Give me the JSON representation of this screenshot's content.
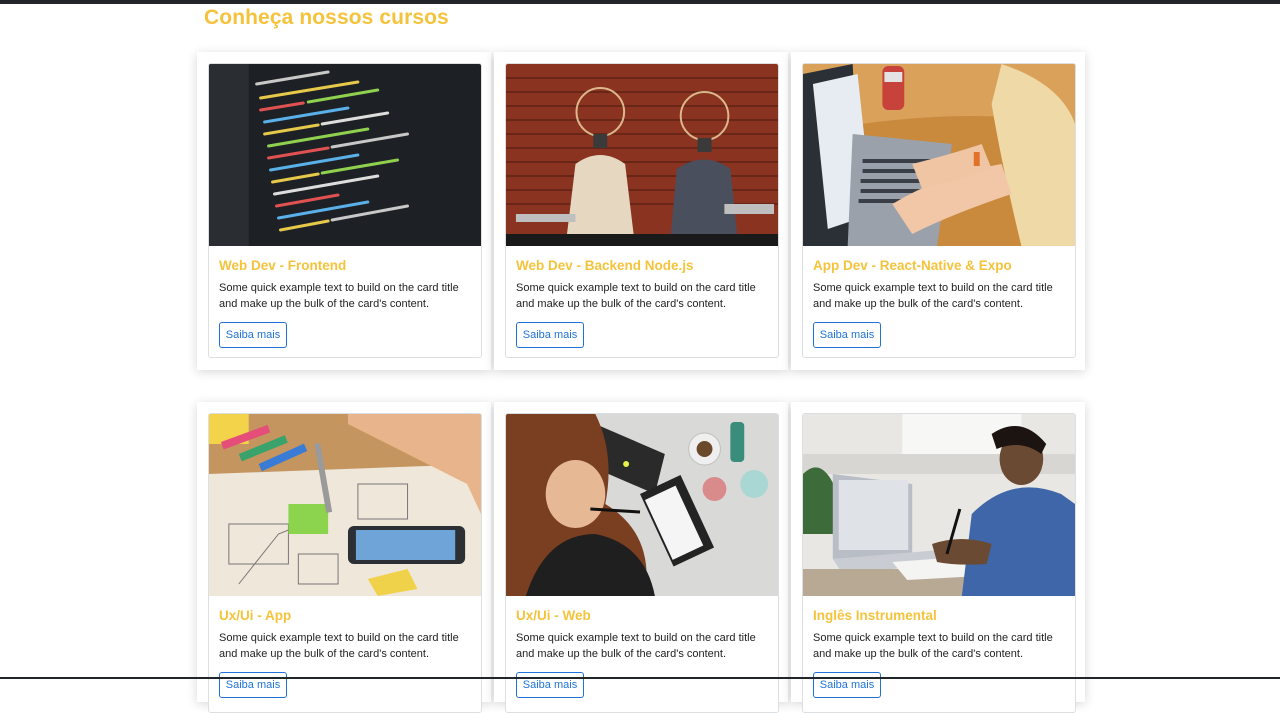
{
  "section": {
    "title": "Conheça nossos cursos"
  },
  "colors": {
    "accent": "#f5c33b",
    "button": "#1f73d8"
  },
  "cards": [
    {
      "image": "code-editor-photo",
      "title": "Web Dev - Frontend",
      "text": "Some quick example text to build on the card title and make up the bulk of the card's content.",
      "button": "Saiba mais"
    },
    {
      "image": "lightbulb-people-photo",
      "title": "Web Dev - Backend Node.js",
      "text": "Some quick example text to build on the card title and make up the bulk of the card's content.",
      "button": "Saiba mais"
    },
    {
      "image": "woman-laptop-photo",
      "title": "App Dev - React-Native & Expo",
      "text": "Some quick example text to build on the card title and make up the bulk of the card's content.",
      "button": "Saiba mais"
    },
    {
      "image": "sketching-wireframe-photo",
      "title": "Ux/Ui - App",
      "text": "Some quick example text to build on the card title and make up the bulk of the card's content.",
      "button": "Saiba mais"
    },
    {
      "image": "woman-desk-photo",
      "title": "Ux/Ui - Web",
      "text": "Some quick example text to build on the card title and make up the bulk of the card's content.",
      "button": "Saiba mais"
    },
    {
      "image": "man-writing-photo",
      "title": "Inglês Instrumental",
      "text": "Some quick example text to build on the card title and make up the bulk of the card's content.",
      "button": "Saiba mais"
    }
  ]
}
